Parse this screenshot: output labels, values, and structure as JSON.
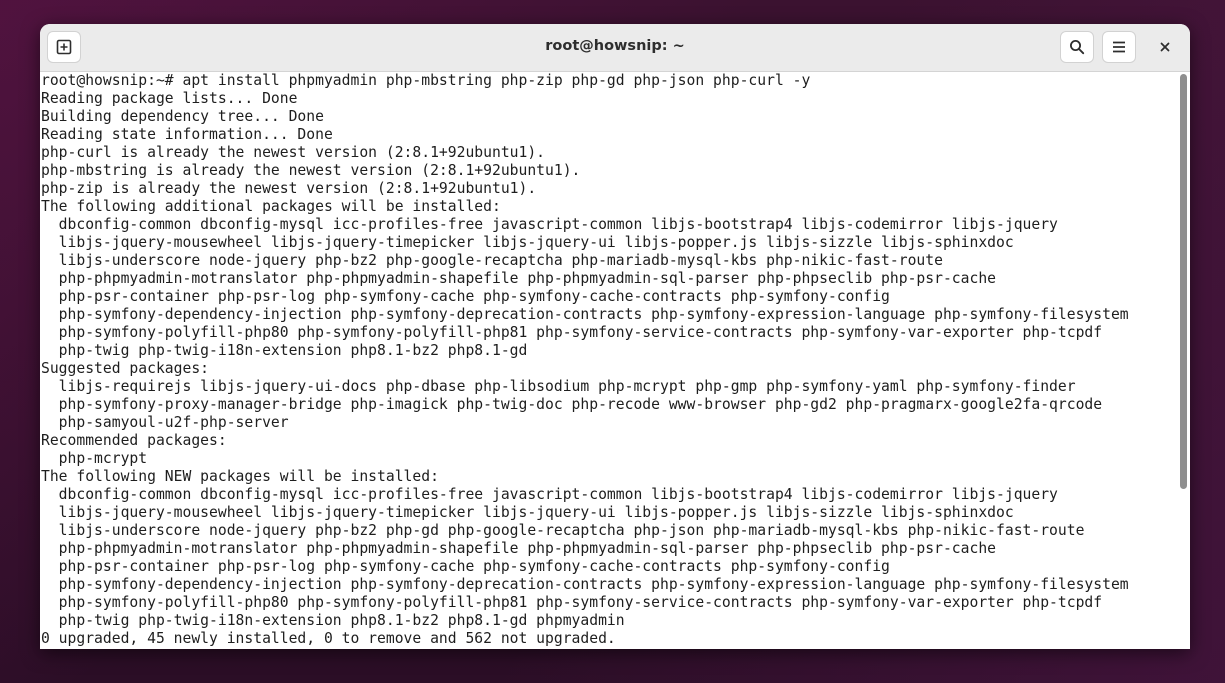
{
  "window": {
    "title": "root@howsnip: ~"
  },
  "toolbar": {
    "new_tab_icon": "new-tab-icon",
    "search_icon": "search-icon",
    "menu_icon": "hamburger-menu-icon",
    "close_icon": "close-icon"
  },
  "terminal": {
    "lines": [
      "root@howsnip:~# apt install phpmyadmin php-mbstring php-zip php-gd php-json php-curl -y",
      "Reading package lists... Done",
      "Building dependency tree... Done",
      "Reading state information... Done",
      "php-curl is already the newest version (2:8.1+92ubuntu1).",
      "php-mbstring is already the newest version (2:8.1+92ubuntu1).",
      "php-zip is already the newest version (2:8.1+92ubuntu1).",
      "The following additional packages will be installed:",
      "  dbconfig-common dbconfig-mysql icc-profiles-free javascript-common libjs-bootstrap4 libjs-codemirror libjs-jquery",
      "  libjs-jquery-mousewheel libjs-jquery-timepicker libjs-jquery-ui libjs-popper.js libjs-sizzle libjs-sphinxdoc",
      "  libjs-underscore node-jquery php-bz2 php-google-recaptcha php-mariadb-mysql-kbs php-nikic-fast-route",
      "  php-phpmyadmin-motranslator php-phpmyadmin-shapefile php-phpmyadmin-sql-parser php-phpseclib php-psr-cache",
      "  php-psr-container php-psr-log php-symfony-cache php-symfony-cache-contracts php-symfony-config",
      "  php-symfony-dependency-injection php-symfony-deprecation-contracts php-symfony-expression-language php-symfony-filesystem",
      "  php-symfony-polyfill-php80 php-symfony-polyfill-php81 php-symfony-service-contracts php-symfony-var-exporter php-tcpdf",
      "  php-twig php-twig-i18n-extension php8.1-bz2 php8.1-gd",
      "Suggested packages:",
      "  libjs-requirejs libjs-jquery-ui-docs php-dbase php-libsodium php-mcrypt php-gmp php-symfony-yaml php-symfony-finder",
      "  php-symfony-proxy-manager-bridge php-imagick php-twig-doc php-recode www-browser php-gd2 php-pragmarx-google2fa-qrcode",
      "  php-samyoul-u2f-php-server",
      "Recommended packages:",
      "  php-mcrypt",
      "The following NEW packages will be installed:",
      "  dbconfig-common dbconfig-mysql icc-profiles-free javascript-common libjs-bootstrap4 libjs-codemirror libjs-jquery",
      "  libjs-jquery-mousewheel libjs-jquery-timepicker libjs-jquery-ui libjs-popper.js libjs-sizzle libjs-sphinxdoc",
      "  libjs-underscore node-jquery php-bz2 php-gd php-google-recaptcha php-json php-mariadb-mysql-kbs php-nikic-fast-route",
      "  php-phpmyadmin-motranslator php-phpmyadmin-shapefile php-phpmyadmin-sql-parser php-phpseclib php-psr-cache",
      "  php-psr-container php-psr-log php-symfony-cache php-symfony-cache-contracts php-symfony-config",
      "  php-symfony-dependency-injection php-symfony-deprecation-contracts php-symfony-expression-language php-symfony-filesystem",
      "  php-symfony-polyfill-php80 php-symfony-polyfill-php81 php-symfony-service-contracts php-symfony-var-exporter php-tcpdf",
      "  php-twig php-twig-i18n-extension php8.1-bz2 php8.1-gd phpmyadmin",
      "0 upgraded, 45 newly installed, 0 to remove and 562 not upgraded."
    ]
  }
}
